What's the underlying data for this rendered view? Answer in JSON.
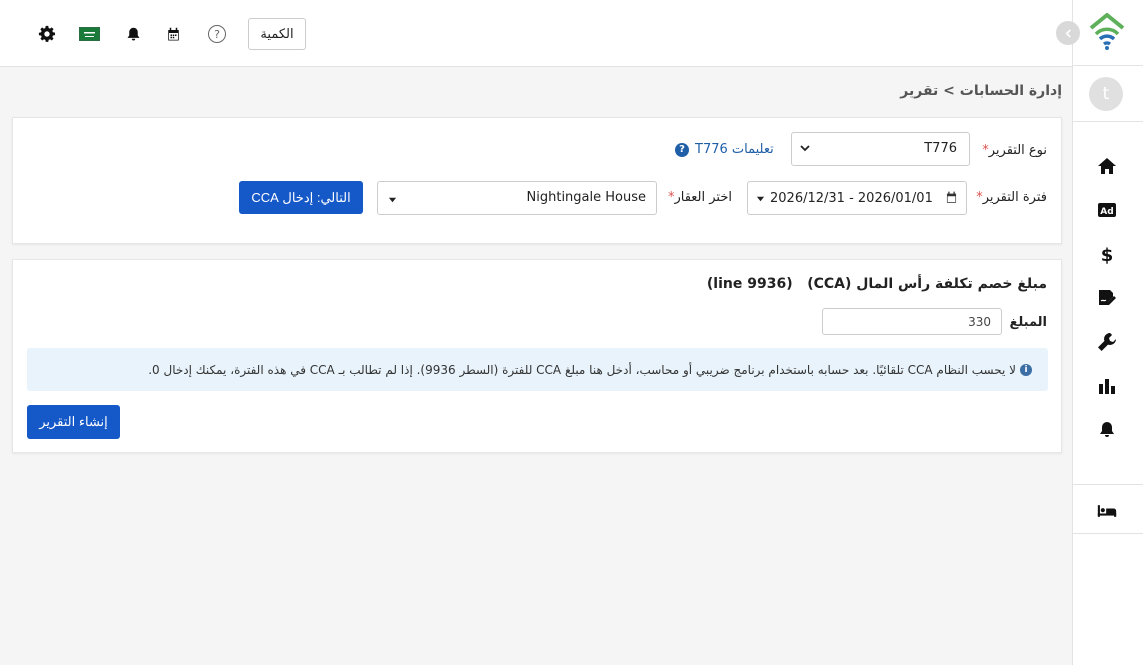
{
  "header": {
    "quantity_button": "الكمية",
    "help_glyph": "?"
  },
  "sidebar": {
    "avatar_letter": "t",
    "nav_items": [
      "home-icon",
      "ad-icon",
      "dollar-icon",
      "signature-icon",
      "wrench-icon",
      "chart-icon",
      "bell-icon",
      "bed-icon"
    ]
  },
  "breadcrumb": "إدارة الحسابات > تقرير",
  "report_form": {
    "report_type_label": "نوع التقرير",
    "report_type_value": "T776",
    "instructions_link": "تعليمات T776",
    "period_label": "فترة التقرير",
    "period_value": "2026/01/01 - 2026/12/31",
    "property_label": "اختر العقار",
    "property_value": "Nightingale House",
    "next_button": "التالي: إدخال CCA",
    "required_mark": "*"
  },
  "cca_section": {
    "title": "مبلغ خصم تكلفة رأس المال (CCA)   (line 9936)",
    "amount_label": "المبلغ",
    "amount_value": "330",
    "info_text": "لا يحسب النظام CCA تلقائيًا. بعد حسابه باستخدام برنامج ضريبي أو محاسب، أدخل هنا مبلغ CCA للفترة (السطر 9936). إذا لم تطالب بـ CCA في هذه الفترة، يمكنك إدخال 0.",
    "create_button": "إنشاء التقرير"
  },
  "colors": {
    "primary": "#1558c8",
    "link": "#1f5fa8",
    "info_bg": "#e8f3fb",
    "required": "#d9534f",
    "logo_green": "#5fb05a",
    "logo_blue": "#2a6fb5"
  }
}
